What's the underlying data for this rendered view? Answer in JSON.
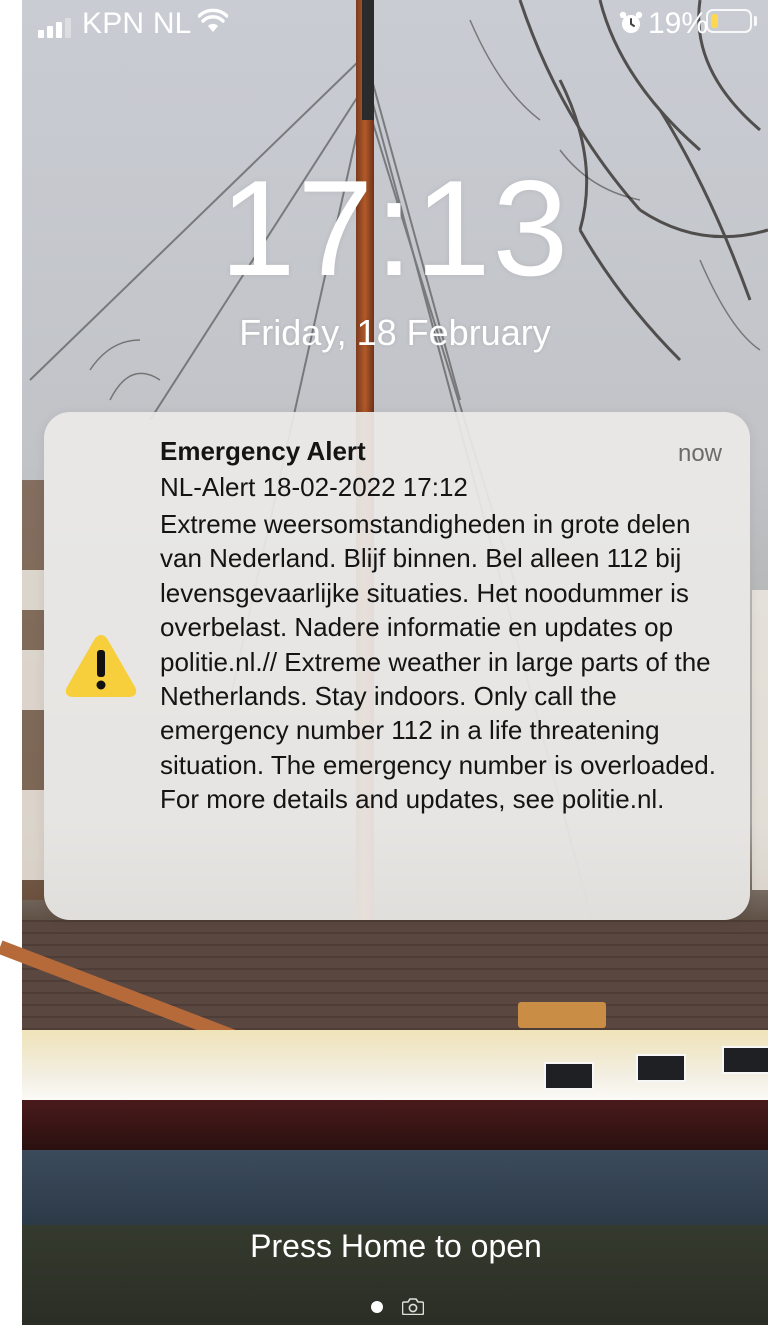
{
  "status_bar": {
    "carrier": "KPN NL",
    "battery_percent": "19%",
    "battery_level": 0.19,
    "signal_bars": 3,
    "icons": [
      "signal-icon",
      "wifi-icon",
      "alarm-icon",
      "battery-icon"
    ]
  },
  "lock_screen": {
    "time": "17:13",
    "date": "Friday, 18 February"
  },
  "notification": {
    "app_icon": "warning-icon",
    "title": "Emergency Alert",
    "time": "now",
    "subtitle": "NL-Alert 18-02-2022 17:12",
    "body": "Extreme weersomstandigheden in grote delen van Nederland. Blijf binnen. Bel alleen 112 bij levensgevaarlijke situaties. Het noodummer is overbelast. Nadere informatie en updates op politie.nl.// Extreme weather in large parts of the Netherlands. Stay indoors. Only call the emergency number 112 in a life threatening situation. The emergency number is overloaded. For more details and updates, see politie.nl."
  },
  "bottom": {
    "home_prompt": "Press Home to open",
    "page_indicator_icons": [
      "page-dot-icon",
      "camera-icon"
    ]
  },
  "colors": {
    "battery_low": "#ffd84d",
    "warning": "#f7cf3c",
    "text_primary": "#141414"
  }
}
